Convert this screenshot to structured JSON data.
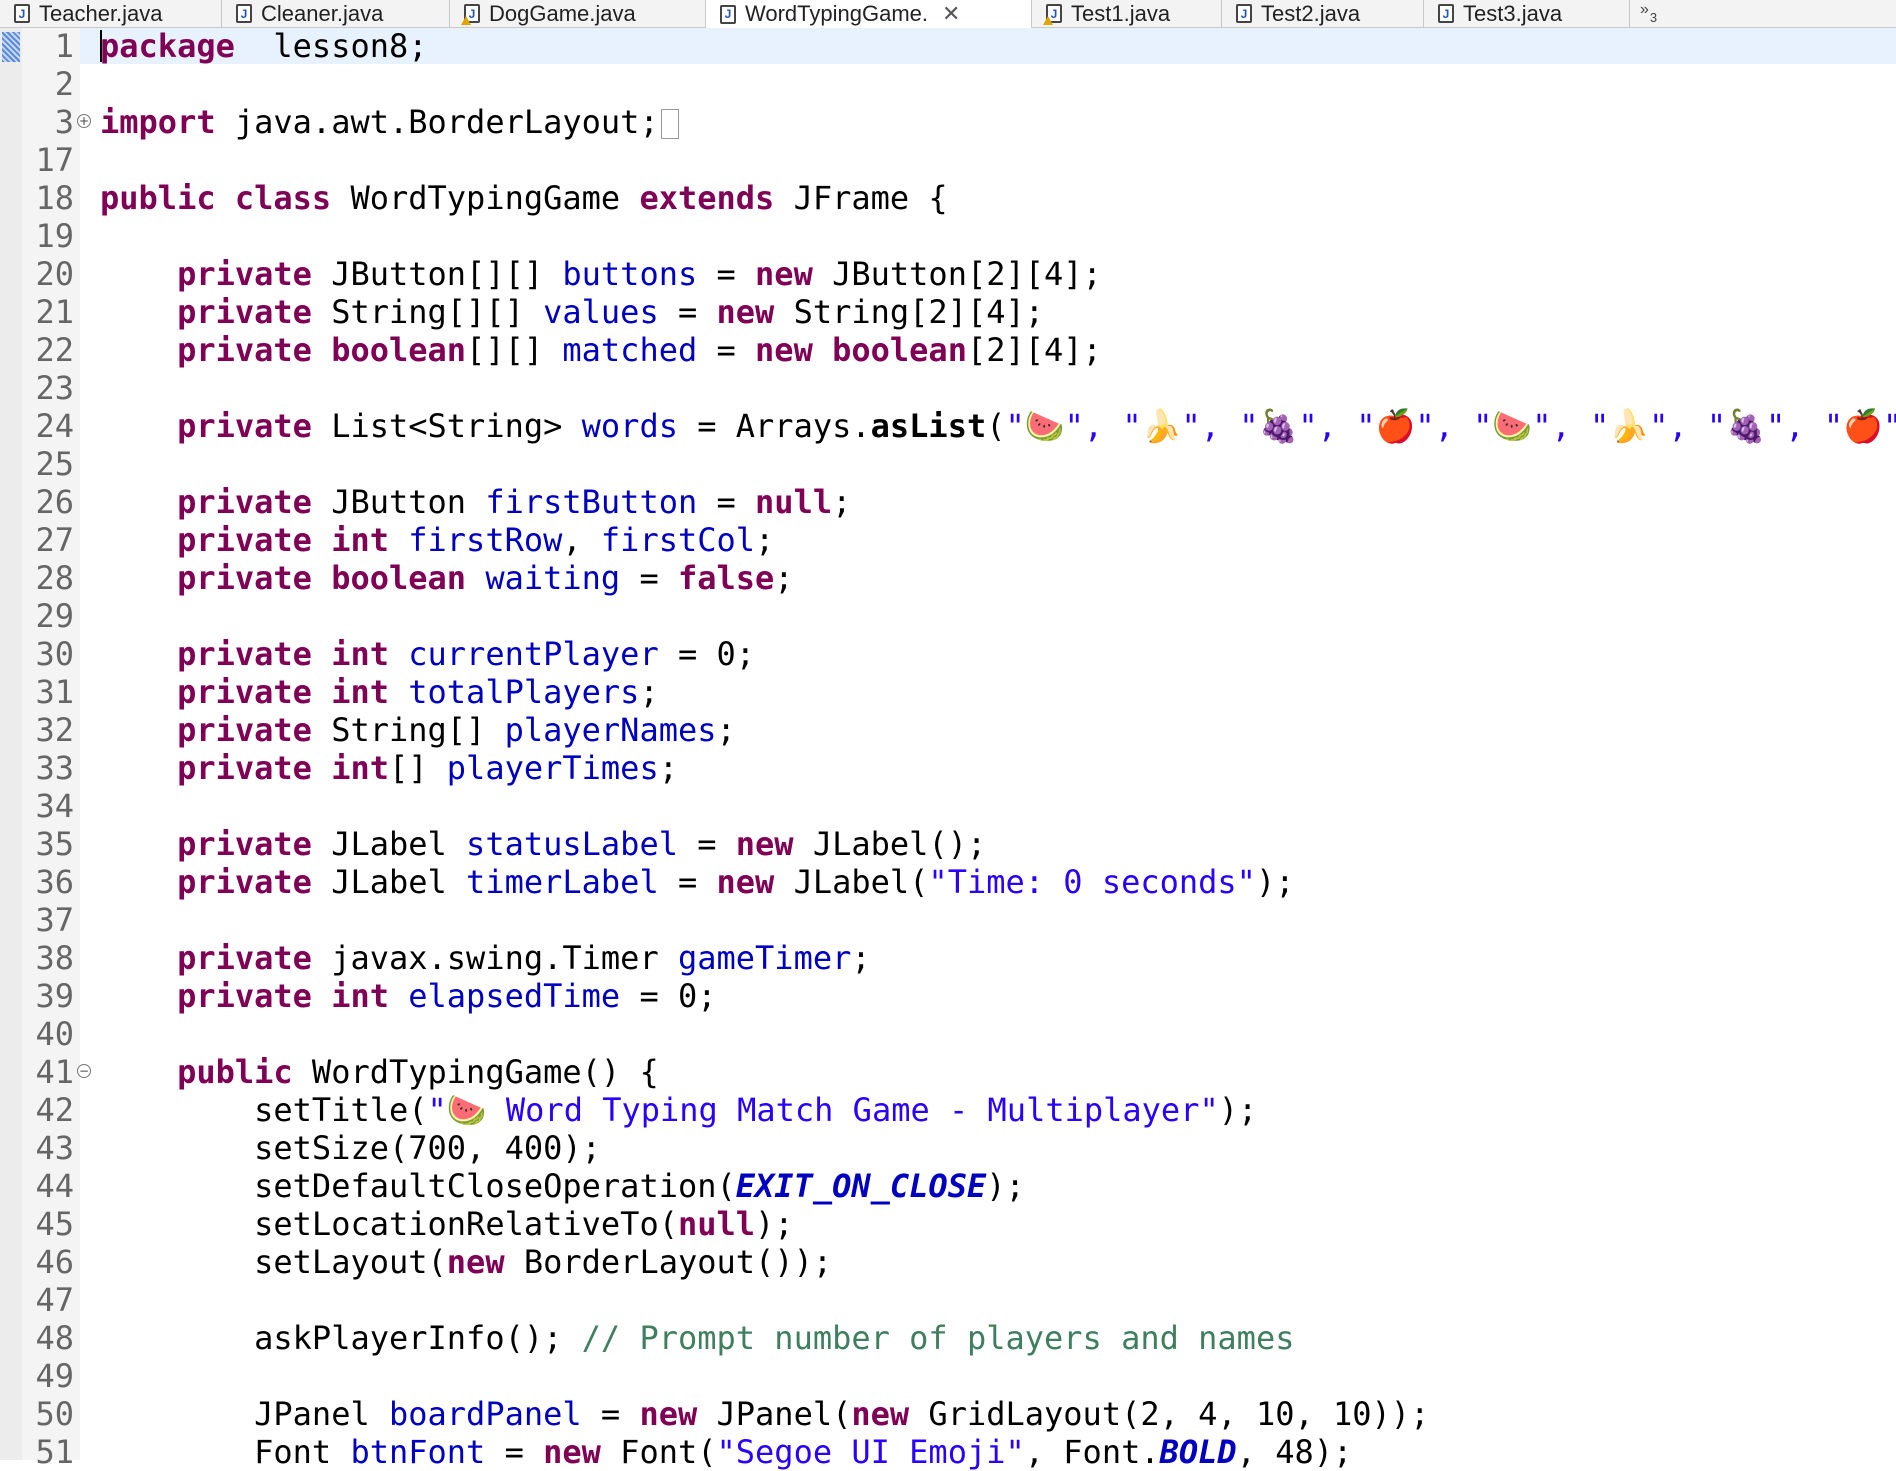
{
  "tabs": [
    {
      "label": "Teacher.java",
      "active": false,
      "warning": false
    },
    {
      "label": "Cleaner.java",
      "active": false,
      "warning": false
    },
    {
      "label": "DogGame.java",
      "active": false,
      "warning": true
    },
    {
      "label": "WordTypingGame.",
      "active": true,
      "warning": false
    },
    {
      "label": "Test1.java",
      "active": false,
      "warning": true
    },
    {
      "label": "Test2.java",
      "active": false,
      "warning": false
    },
    {
      "label": "Test3.java",
      "active": false,
      "warning": false
    }
  ],
  "tab_overflow": {
    "chevron": "»",
    "count": "3"
  },
  "icons": {
    "file": "java-file-icon",
    "warning": "warning-icon",
    "close": "close-icon",
    "fold_expand": "fold-expand-icon",
    "fold_collapse": "fold-collapse-icon"
  },
  "colors": {
    "keyword": "#7f0055",
    "field": "#0000c0",
    "string": "#2a00ff",
    "comment": "#3f7f5f",
    "current_line": "#e8f2fe"
  },
  "editor": {
    "lines": [
      {
        "num": "1",
        "tokens": [
          [
            "kw",
            "package"
          ],
          [
            "",
            "  lesson8;"
          ]
        ]
      },
      {
        "num": "2",
        "tokens": []
      },
      {
        "num": "3",
        "fold": "expand",
        "foldbox": true,
        "tokens": [
          [
            "kw",
            "import"
          ],
          [
            "",
            " java.awt.BorderLayout;"
          ]
        ]
      },
      {
        "num": "17",
        "tokens": []
      },
      {
        "num": "18",
        "tokens": [
          [
            "kw",
            "public"
          ],
          [
            "",
            " "
          ],
          [
            "kw",
            "class"
          ],
          [
            "",
            " WordTypingGame "
          ],
          [
            "kw",
            "extends"
          ],
          [
            "",
            " JFrame {"
          ]
        ]
      },
      {
        "num": "19",
        "tokens": []
      },
      {
        "num": "20",
        "tokens": [
          [
            "",
            "    "
          ],
          [
            "kw",
            "private"
          ],
          [
            "",
            " JButton[][] "
          ],
          [
            "fld",
            "buttons"
          ],
          [
            "",
            " = "
          ],
          [
            "kw",
            "new"
          ],
          [
            "",
            " JButton[2][4];"
          ]
        ]
      },
      {
        "num": "21",
        "tokens": [
          [
            "",
            "    "
          ],
          [
            "kw",
            "private"
          ],
          [
            "",
            " String[][] "
          ],
          [
            "fld",
            "values"
          ],
          [
            "",
            " = "
          ],
          [
            "kw",
            "new"
          ],
          [
            "",
            " String[2][4];"
          ]
        ]
      },
      {
        "num": "22",
        "tokens": [
          [
            "",
            "    "
          ],
          [
            "kw",
            "private"
          ],
          [
            "",
            " "
          ],
          [
            "kw",
            "boolean"
          ],
          [
            "",
            "[][] "
          ],
          [
            "fld",
            "matched"
          ],
          [
            "",
            " = "
          ],
          [
            "kw",
            "new"
          ],
          [
            "",
            " "
          ],
          [
            "kw",
            "boolean"
          ],
          [
            "",
            "[2][4];"
          ]
        ]
      },
      {
        "num": "23",
        "tokens": []
      },
      {
        "num": "24",
        "tokens": [
          [
            "",
            "    "
          ],
          [
            "kw",
            "private"
          ],
          [
            "",
            " List<String> "
          ],
          [
            "fld",
            "words"
          ],
          [
            "",
            " = Arrays."
          ],
          [
            "bold",
            "asList"
          ],
          [
            "",
            "("
          ],
          [
            "str",
            "\"🍉\", \"🍌\", \"🍇\", \"🍎\", \"🍉\", \"🍌\", \"🍇\", \"🍎\""
          ],
          [
            "",
            ");"
          ]
        ]
      },
      {
        "num": "25",
        "tokens": []
      },
      {
        "num": "26",
        "tokens": [
          [
            "",
            "    "
          ],
          [
            "kw",
            "private"
          ],
          [
            "",
            " JButton "
          ],
          [
            "fld",
            "firstButton"
          ],
          [
            "",
            " = "
          ],
          [
            "kw",
            "null"
          ],
          [
            "",
            ";"
          ]
        ]
      },
      {
        "num": "27",
        "tokens": [
          [
            "",
            "    "
          ],
          [
            "kw",
            "private"
          ],
          [
            "",
            " "
          ],
          [
            "kw",
            "int"
          ],
          [
            "",
            " "
          ],
          [
            "fld",
            "firstRow"
          ],
          [
            "",
            ", "
          ],
          [
            "fld",
            "firstCol"
          ],
          [
            "",
            ";"
          ]
        ]
      },
      {
        "num": "28",
        "tokens": [
          [
            "",
            "    "
          ],
          [
            "kw",
            "private"
          ],
          [
            "",
            " "
          ],
          [
            "kw",
            "boolean"
          ],
          [
            "",
            " "
          ],
          [
            "fld",
            "waiting"
          ],
          [
            "",
            " = "
          ],
          [
            "kw",
            "false"
          ],
          [
            "",
            ";"
          ]
        ]
      },
      {
        "num": "29",
        "tokens": []
      },
      {
        "num": "30",
        "tokens": [
          [
            "",
            "    "
          ],
          [
            "kw",
            "private"
          ],
          [
            "",
            " "
          ],
          [
            "kw",
            "int"
          ],
          [
            "",
            " "
          ],
          [
            "fld",
            "currentPlayer"
          ],
          [
            "",
            " = 0;"
          ]
        ]
      },
      {
        "num": "31",
        "tokens": [
          [
            "",
            "    "
          ],
          [
            "kw",
            "private"
          ],
          [
            "",
            " "
          ],
          [
            "kw",
            "int"
          ],
          [
            "",
            " "
          ],
          [
            "fld",
            "totalPlayers"
          ],
          [
            "",
            ";"
          ]
        ]
      },
      {
        "num": "32",
        "tokens": [
          [
            "",
            "    "
          ],
          [
            "kw",
            "private"
          ],
          [
            "",
            " String[] "
          ],
          [
            "fld",
            "playerNames"
          ],
          [
            "",
            ";"
          ]
        ]
      },
      {
        "num": "33",
        "tokens": [
          [
            "",
            "    "
          ],
          [
            "kw",
            "private"
          ],
          [
            "",
            " "
          ],
          [
            "kw",
            "int"
          ],
          [
            "",
            "[] "
          ],
          [
            "fld",
            "playerTimes"
          ],
          [
            "",
            ";"
          ]
        ]
      },
      {
        "num": "34",
        "tokens": []
      },
      {
        "num": "35",
        "tokens": [
          [
            "",
            "    "
          ],
          [
            "kw",
            "private"
          ],
          [
            "",
            " JLabel "
          ],
          [
            "fld",
            "statusLabel"
          ],
          [
            "",
            " = "
          ],
          [
            "kw",
            "new"
          ],
          [
            "",
            " JLabel();"
          ]
        ]
      },
      {
        "num": "36",
        "tokens": [
          [
            "",
            "    "
          ],
          [
            "kw",
            "private"
          ],
          [
            "",
            " JLabel "
          ],
          [
            "fld",
            "timerLabel"
          ],
          [
            "",
            " = "
          ],
          [
            "kw",
            "new"
          ],
          [
            "",
            " JLabel("
          ],
          [
            "str",
            "\"Time: 0 seconds\""
          ],
          [
            "",
            ");"
          ]
        ]
      },
      {
        "num": "37",
        "tokens": []
      },
      {
        "num": "38",
        "tokens": [
          [
            "",
            "    "
          ],
          [
            "kw",
            "private"
          ],
          [
            "",
            " javax.swing.Timer "
          ],
          [
            "fld",
            "gameTimer"
          ],
          [
            "",
            ";"
          ]
        ]
      },
      {
        "num": "39",
        "tokens": [
          [
            "",
            "    "
          ],
          [
            "kw",
            "private"
          ],
          [
            "",
            " "
          ],
          [
            "kw",
            "int"
          ],
          [
            "",
            " "
          ],
          [
            "fld",
            "elapsedTime"
          ],
          [
            "",
            " = 0;"
          ]
        ]
      },
      {
        "num": "40",
        "tokens": []
      },
      {
        "num": "41",
        "fold": "collapse",
        "tokens": [
          [
            "",
            "    "
          ],
          [
            "kw",
            "public"
          ],
          [
            "",
            " WordTypingGame() {"
          ]
        ]
      },
      {
        "num": "42",
        "tokens": [
          [
            "",
            "        setTitle("
          ],
          [
            "str",
            "\"🍉 Word Typing Match Game - Multiplayer\""
          ],
          [
            "",
            ");"
          ]
        ]
      },
      {
        "num": "43",
        "tokens": [
          [
            "",
            "        setSize(700, 400);"
          ]
        ]
      },
      {
        "num": "44",
        "tokens": [
          [
            "",
            "        setDefaultCloseOperation("
          ],
          [
            "cst",
            "EXIT_ON_CLOSE"
          ],
          [
            "",
            ");"
          ]
        ]
      },
      {
        "num": "45",
        "tokens": [
          [
            "",
            "        setLocationRelativeTo("
          ],
          [
            "kw",
            "null"
          ],
          [
            "",
            ");"
          ]
        ]
      },
      {
        "num": "46",
        "tokens": [
          [
            "",
            "        setLayout("
          ],
          [
            "kw",
            "new"
          ],
          [
            "",
            " BorderLayout());"
          ]
        ]
      },
      {
        "num": "47",
        "tokens": []
      },
      {
        "num": "48",
        "tokens": [
          [
            "",
            "        askPlayerInfo(); "
          ],
          [
            "cmt",
            "// Prompt number of players and names"
          ]
        ]
      },
      {
        "num": "49",
        "tokens": []
      },
      {
        "num": "50",
        "tokens": [
          [
            "",
            "        JPanel "
          ],
          [
            "fld",
            "boardPanel"
          ],
          [
            "",
            " = "
          ],
          [
            "kw",
            "new"
          ],
          [
            "",
            " JPanel("
          ],
          [
            "kw",
            "new"
          ],
          [
            "",
            " GridLayout(2, 4, 10, 10));"
          ]
        ]
      },
      {
        "num": "51",
        "tokens": [
          [
            "",
            "        Font "
          ],
          [
            "fld",
            "btnFont"
          ],
          [
            "",
            " = "
          ],
          [
            "kw",
            "new"
          ],
          [
            "",
            " Font("
          ],
          [
            "str",
            "\"Segoe UI Emoji\""
          ],
          [
            "",
            ", Font."
          ],
          [
            "cst",
            "BOLD"
          ],
          [
            "",
            ", 48);"
          ]
        ]
      }
    ]
  }
}
